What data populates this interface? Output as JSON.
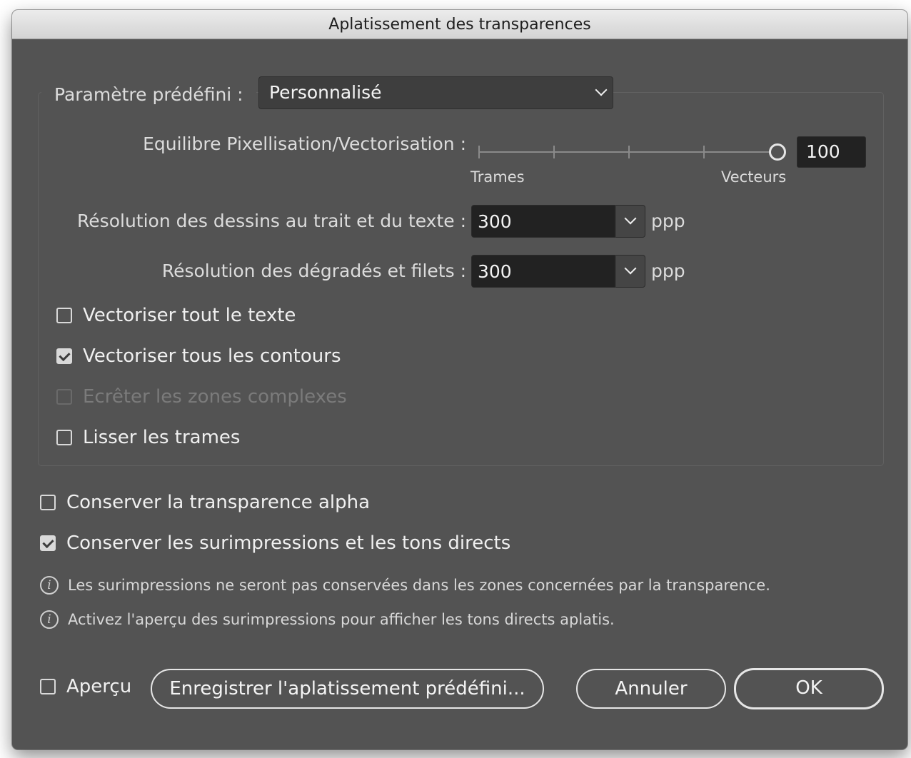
{
  "window": {
    "title": "Aplatissement des transparences"
  },
  "preset": {
    "label": "Paramètre prédéfini :",
    "value": "Personnalisé"
  },
  "balance": {
    "label": "Equilibre Pixellisation/Vectorisation :",
    "min_label": "Trames",
    "max_label": "Vecteurs",
    "value": "100",
    "slider_fraction": 1.0
  },
  "line_art_resolution": {
    "label": "Résolution des dessins au trait et du texte :",
    "value": "300",
    "unit": "ppp"
  },
  "gradient_resolution": {
    "label": "Résolution des dégradés et filets :",
    "value": "300",
    "unit": "ppp"
  },
  "options": [
    {
      "label": "Vectoriser tout le texte",
      "checked": false,
      "enabled": true
    },
    {
      "label": "Vectoriser tous les contours",
      "checked": true,
      "enabled": true
    },
    {
      "label": "Ecrêter les zones complexes",
      "checked": false,
      "enabled": false
    },
    {
      "label": "Lisser les trames",
      "checked": false,
      "enabled": true
    }
  ],
  "preserve": [
    {
      "label": "Conserver la transparence alpha",
      "checked": false
    },
    {
      "label": "Conserver les surimpressions et les tons directs",
      "checked": true
    }
  ],
  "info": [
    {
      "icon": "info-icon",
      "text": "Les surimpressions ne seront pas conservées dans les zones concernées par la transparence."
    },
    {
      "icon": "info-icon",
      "text": "Activez l'aperçu des surimpressions pour afficher les tons directs aplatis."
    }
  ],
  "footer": {
    "preview_label": "Aperçu",
    "preview_checked": false,
    "save_preset_label": "Enregistrer l'aplatissement prédéfini...",
    "cancel_label": "Annuler",
    "ok_label": "OK"
  },
  "colors": {
    "dialog_bg": "#535353",
    "field_bg": "#222222",
    "titlebar": "#dcdcdc"
  }
}
